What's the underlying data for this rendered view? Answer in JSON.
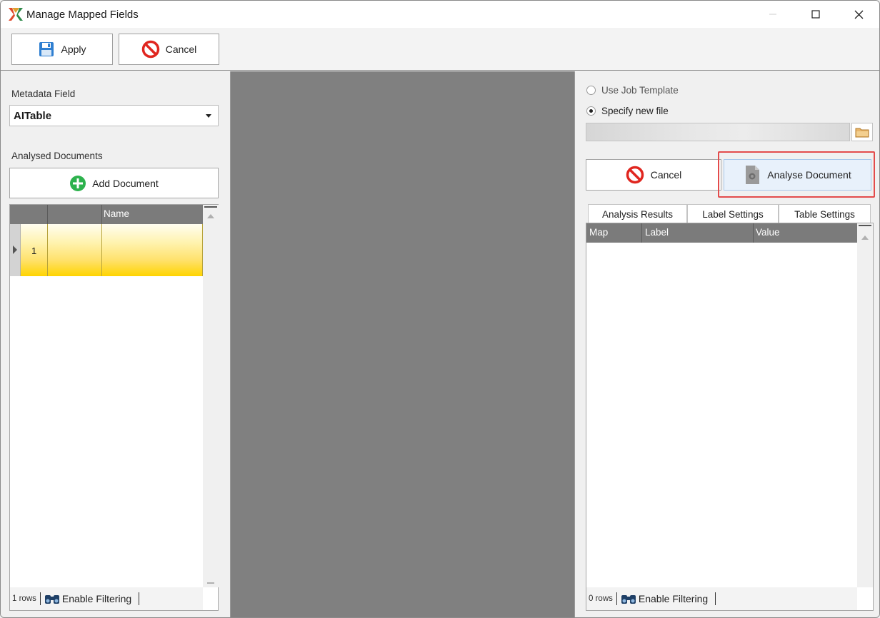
{
  "window": {
    "title": "Manage Mapped Fields"
  },
  "toolbar": {
    "apply_label": "Apply",
    "cancel_label": "Cancel"
  },
  "left": {
    "metadata_label": "Metadata Field",
    "metadata_value": "AITable",
    "analysed_label": "Analysed Documents",
    "add_document_label": "Add Document",
    "grid": {
      "columns": [
        "",
        "",
        "Name"
      ],
      "rows": [
        {
          "num": "1",
          "name": ""
        }
      ],
      "rows_count": "1 rows",
      "filter_label": "Enable Filtering"
    }
  },
  "right": {
    "use_template_label": "Use Job Template",
    "specify_file_label": "Specify new file",
    "file_path": "",
    "cancel_label": "Cancel",
    "analyse_label": "Analyse Document",
    "tabs": [
      "Analysis Results",
      "Label Settings",
      "Table Settings"
    ],
    "grid": {
      "columns": [
        "Map",
        "Label",
        "Value"
      ],
      "rows_count": "0 rows",
      "filter_label": "Enable Filtering"
    }
  },
  "colors": {
    "accent_red": "#e34b4b",
    "row_highlight": "#ffd400",
    "header_gray": "#7b7b7b"
  }
}
